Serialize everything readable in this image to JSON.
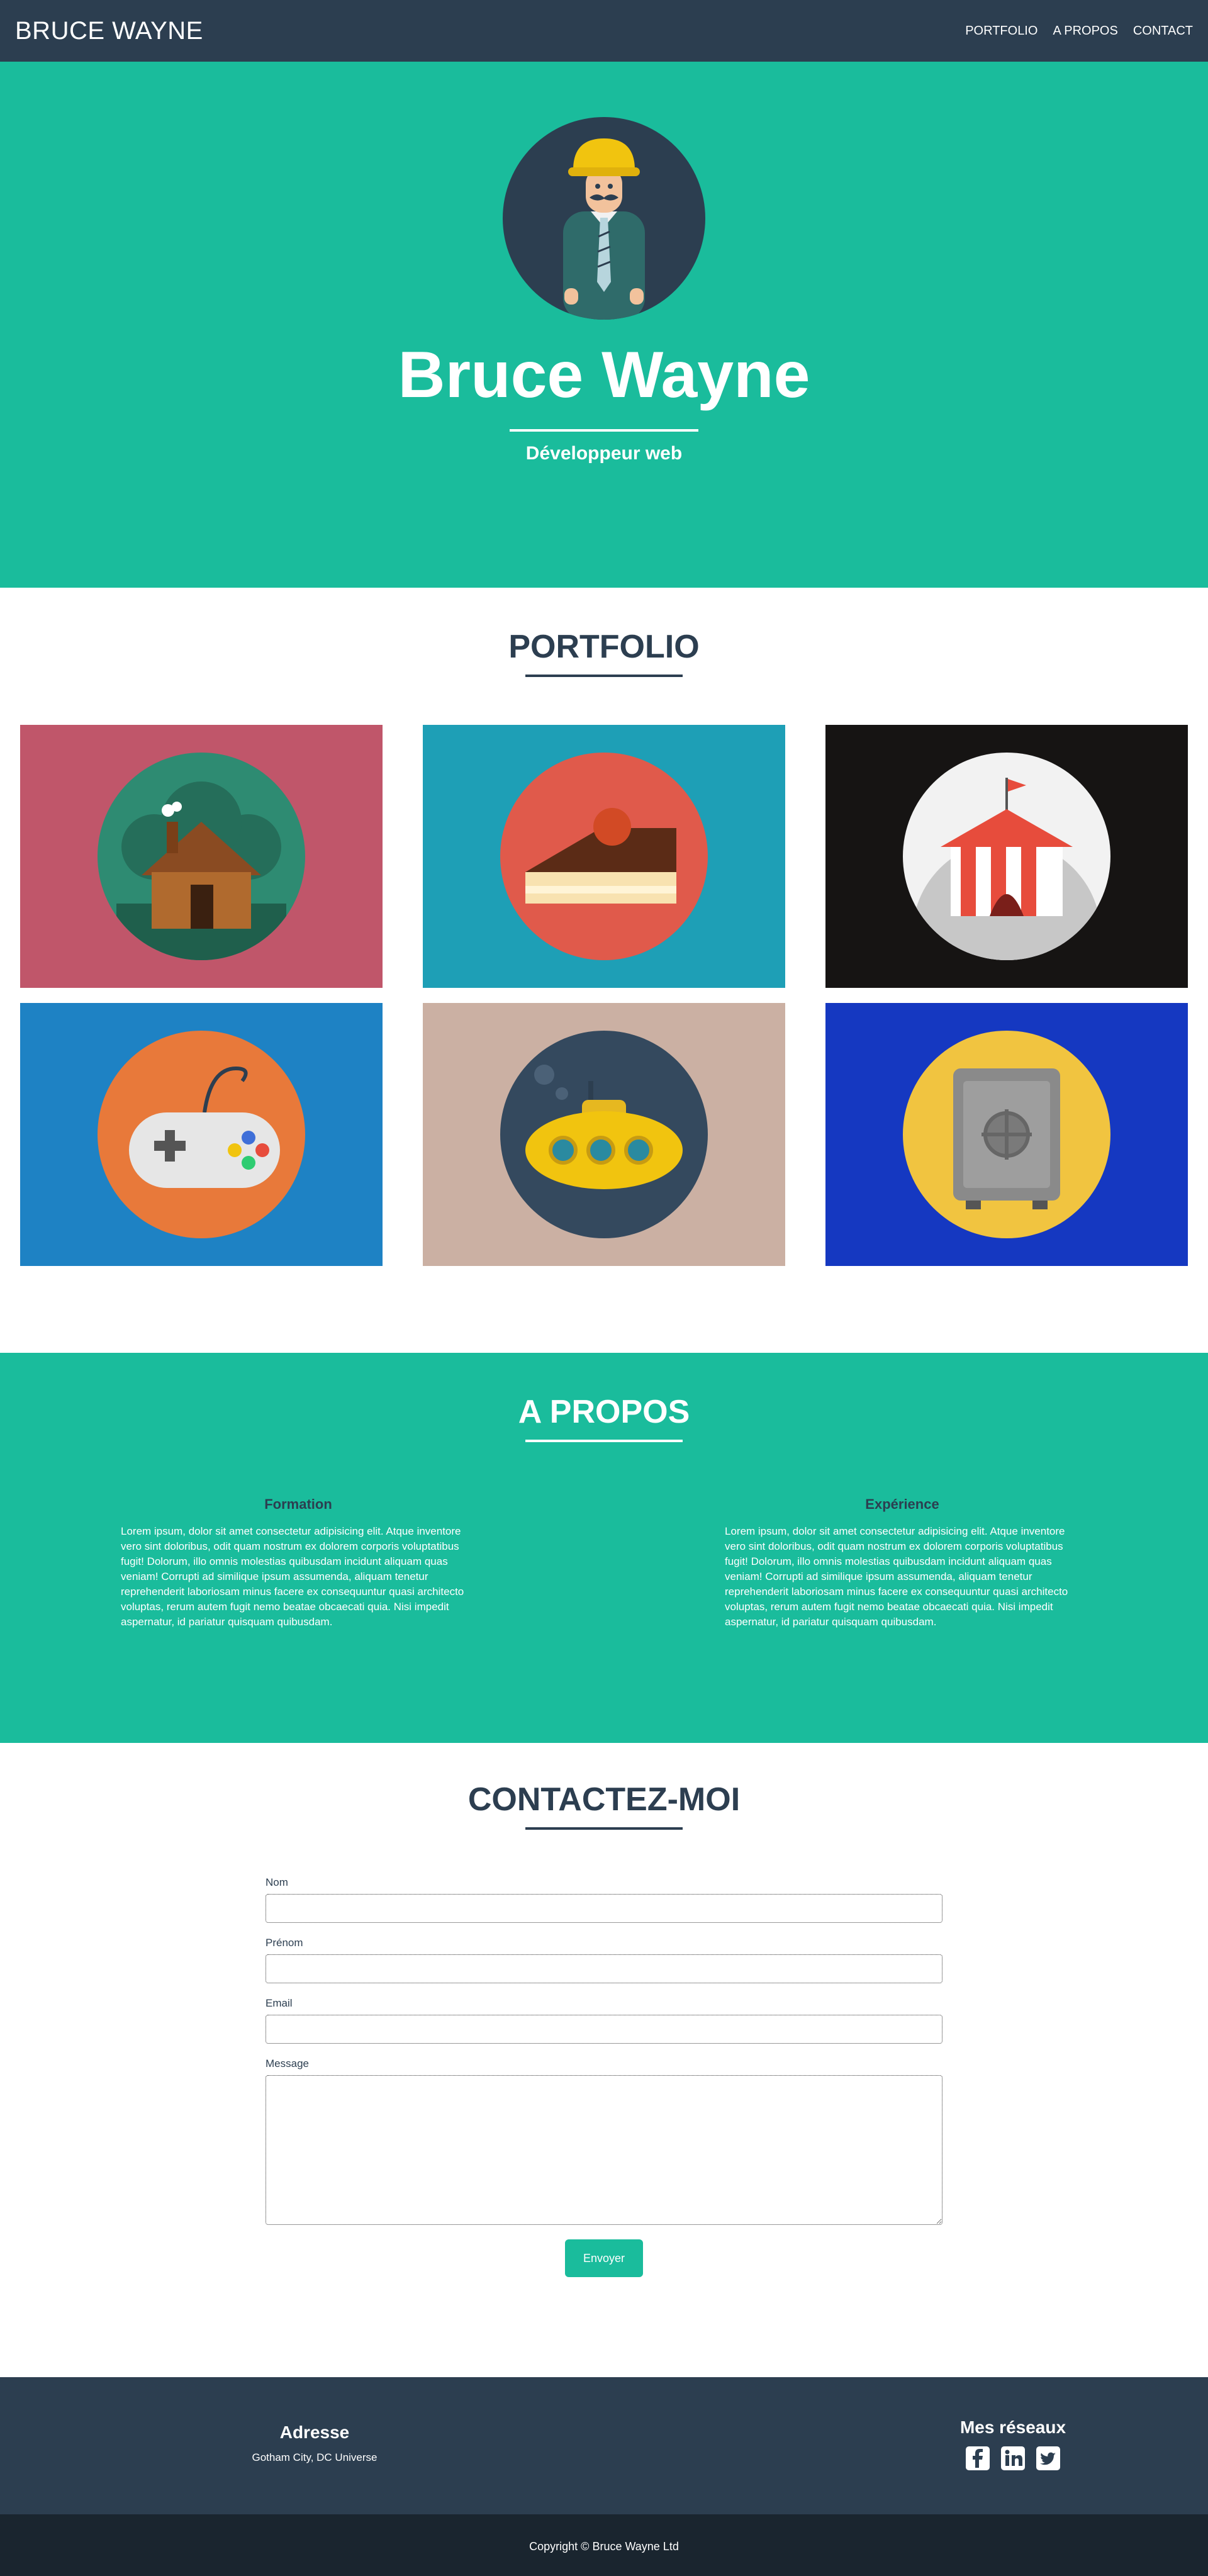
{
  "nav": {
    "brand": "BRUCE WAYNE",
    "links": [
      "PORTFOLIO",
      "A PROPOS",
      "CONTACT"
    ]
  },
  "hero": {
    "name": "Bruce Wayne",
    "subtitle": "Développeur web"
  },
  "portfolio": {
    "title": "PORTFOLIO",
    "items": [
      {
        "bg": "#c0566a",
        "disc": "#2e8b72",
        "icon": "cabin-icon"
      },
      {
        "bg": "#1e9fb6",
        "disc": "#e05a4b",
        "icon": "cake-icon"
      },
      {
        "bg": "#161413",
        "disc": "#f2f2f2",
        "icon": "circus-tent-icon"
      },
      {
        "bg": "#1e82c4",
        "disc": "#e8793a",
        "icon": "game-controller-icon"
      },
      {
        "bg": "#cbb0a3",
        "disc": "#34495e",
        "icon": "submarine-icon"
      },
      {
        "bg": "#1538c1",
        "disc": "#f1c440",
        "icon": "safe-icon"
      }
    ]
  },
  "about": {
    "title": "A PROPOS",
    "columns": [
      {
        "heading": "Formation",
        "text": "Lorem ipsum, dolor sit amet consectetur adipisicing elit. Atque inventore vero sint doloribus, odit quam nostrum ex dolorem corporis voluptatibus fugit! Dolorum, illo omnis molestias quibusdam incidunt aliquam quas veniam! Corrupti ad similique ipsum assumenda, aliquam tenetur reprehenderit laboriosam minus facere ex consequuntur quasi architecto voluptas, rerum autem fugit nemo beatae obcaecati quia. Nisi impedit aspernatur, id pariatur quisquam quibusdam."
      },
      {
        "heading": "Expérience",
        "text": "Lorem ipsum, dolor sit amet consectetur adipisicing elit. Atque inventore vero sint doloribus, odit quam nostrum ex dolorem corporis voluptatibus fugit! Dolorum, illo omnis molestias quibusdam incidunt aliquam quas veniam! Corrupti ad similique ipsum assumenda, aliquam tenetur reprehenderit laboriosam minus facere ex consequuntur quasi architecto voluptas, rerum autem fugit nemo beatae obcaecati quia. Nisi impedit aspernatur, id pariatur quisquam quibusdam."
      }
    ]
  },
  "contact": {
    "title": "CONTACTEZ-MOI",
    "fields": [
      "Nom",
      "Prénom",
      "Email",
      "Message"
    ],
    "submit": "Envoyer"
  },
  "footer": {
    "address_title": "Adresse",
    "address": "Gotham City, DC Universe",
    "social_title": "Mes réseaux",
    "social_icons": [
      "facebook-icon",
      "linkedin-icon",
      "twitter-icon"
    ],
    "copyright": "Copyright © Bruce Wayne Ltd"
  },
  "colors": {
    "accent": "#1abc9c",
    "dark": "#2c3e50",
    "darker": "#1a252f"
  }
}
